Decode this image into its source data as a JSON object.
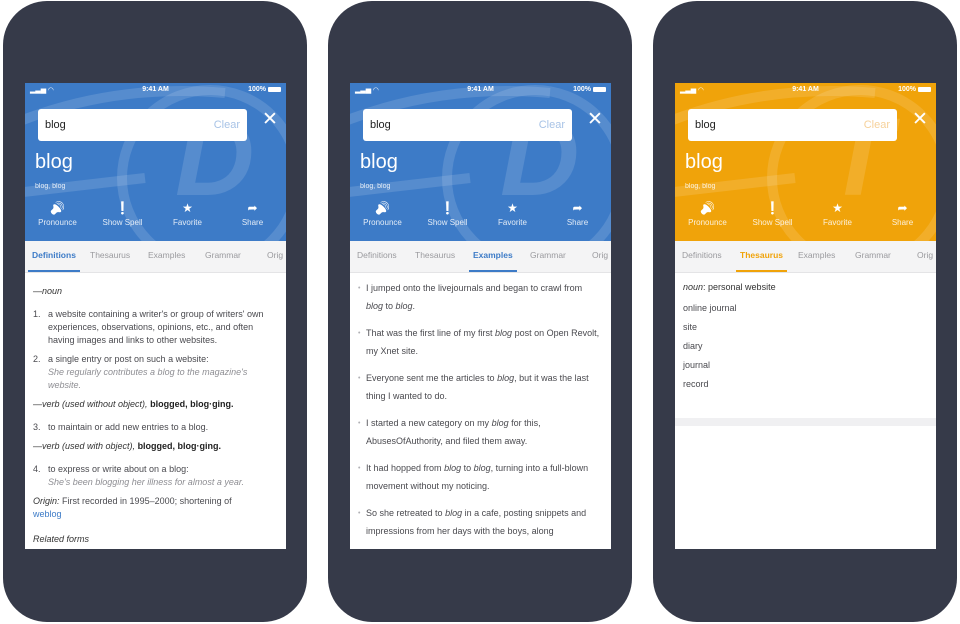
{
  "colors": {
    "blue": "#3d7bc7",
    "orange": "#f0a30a",
    "frame": "#363a49"
  },
  "phones": [
    {
      "theme": "#3d7bc7",
      "clear_color": "#a8c3e6",
      "watermark_letter": "D",
      "status": {
        "time": "9:41 AM",
        "battery": "100%"
      },
      "search": {
        "value": "blog",
        "clear": "Clear"
      },
      "close_icon": "✕",
      "word": "blog",
      "pronunciation": "blog, blog",
      "actions": [
        {
          "icon": "speaker-icon",
          "glyph": "🔊",
          "label": "Pronounce"
        },
        {
          "icon": "exclamation-icon",
          "glyph": "❗",
          "label": "Show Spell"
        },
        {
          "icon": "star-icon",
          "glyph": "★",
          "label": "Favorite"
        },
        {
          "icon": "share-icon",
          "glyph": "➦",
          "label": "Share"
        }
      ],
      "tabs": [
        "Definitions",
        "Thesaurus",
        "Examples",
        "Grammar",
        "Orig"
      ],
      "active_tab": 0,
      "definitions": {
        "noun_label": "—noun",
        "items": [
          {
            "n": "1.",
            "text": "a website containing a writer's or group of writers' own experiences, observations, opinions, etc., and often having images and links to other websites."
          },
          {
            "n": "2.",
            "text": "a single entry or post on such a website:",
            "example": "She regularly contributes a blog to the magazine's website."
          }
        ],
        "verb1_label": "—verb (used without object),",
        "verb1_forms": "blogged, blog·ging.",
        "items2": [
          {
            "n": "3.",
            "text": "to maintain or add new entries to a blog."
          }
        ],
        "verb2_label": "—verb (used with object),",
        "verb2_forms": "blogged, blog·ging.",
        "items3": [
          {
            "n": "4.",
            "text": "to express or write about on a blog:",
            "example": "She's been blogging her illness for almost a year."
          }
        ],
        "origin_label": "Origin:",
        "origin_text": "First recorded in 1995–2000; shortening of",
        "origin_link": "weblog",
        "related": "Related forms"
      }
    },
    {
      "theme": "#3d7bc7",
      "clear_color": "#a8c3e6",
      "watermark_letter": "D",
      "status": {
        "time": "9:41 AM",
        "battery": "100%"
      },
      "search": {
        "value": "blog",
        "clear": "Clear"
      },
      "close_icon": "✕",
      "word": "blog",
      "pronunciation": "blog, blog",
      "actions": [
        {
          "icon": "speaker-icon",
          "glyph": "🔊",
          "label": "Pronounce"
        },
        {
          "icon": "exclamation-icon",
          "glyph": "❗",
          "label": "Show Spell"
        },
        {
          "icon": "star-icon",
          "glyph": "★",
          "label": "Favorite"
        },
        {
          "icon": "share-icon",
          "glyph": "➦",
          "label": "Share"
        }
      ],
      "tabs": [
        "Definitions",
        "Thesaurus",
        "Examples",
        "Grammar",
        "Orig"
      ],
      "active_tab": 2,
      "examples": [
        [
          [
            "I jumped onto the livejournals and began to crawl from ",
            0
          ],
          [
            "blog",
            1
          ],
          [
            " to ",
            0
          ],
          [
            "blog",
            1
          ],
          [
            ".",
            0
          ]
        ],
        [
          [
            "That was the first line of my first ",
            0
          ],
          [
            "blog",
            1
          ],
          [
            " post on Open Revolt, my Xnet site.",
            0
          ]
        ],
        [
          [
            "Everyone sent me the articles to ",
            0
          ],
          [
            "blog",
            1
          ],
          [
            ", but it was the last thing I wanted to do.",
            0
          ]
        ],
        [
          [
            "I started a new category on my ",
            0
          ],
          [
            "blog",
            1
          ],
          [
            " for this, AbusesOfAuthority, and filed them away.",
            0
          ]
        ],
        [
          [
            "It had hopped from ",
            0
          ],
          [
            "blog",
            1
          ],
          [
            " to ",
            0
          ],
          [
            "blog",
            1
          ],
          [
            ", turning into a full-blown movement without my noticing.",
            0
          ]
        ],
        [
          [
            "So she retreated to ",
            0
          ],
          [
            "blog",
            1
          ],
          [
            " in a cafe, posting snippets and impressions from her days with the boys, along",
            0
          ]
        ]
      ]
    },
    {
      "theme": "#f0a30a",
      "clear_color": "#f6d19a",
      "watermark_letter": "T",
      "status": {
        "time": "9:41 AM",
        "battery": "100%"
      },
      "search": {
        "value": "blog",
        "clear": "Clear"
      },
      "close_icon": "✕",
      "word": "blog",
      "pronunciation": "blog, blog",
      "actions": [
        {
          "icon": "speaker-icon",
          "glyph": "🔊",
          "label": "Pronounce"
        },
        {
          "icon": "exclamation-icon",
          "glyph": "❗",
          "label": "Show Spell"
        },
        {
          "icon": "star-icon",
          "glyph": "★",
          "label": "Favorite"
        },
        {
          "icon": "share-icon",
          "glyph": "➦",
          "label": "Share"
        }
      ],
      "tabs": [
        "Definitions",
        "Thesaurus",
        "Examples",
        "Grammar",
        "Orig"
      ],
      "active_tab": 1,
      "thesaurus": {
        "pos": "noun",
        "sense": ": personal website",
        "words": [
          "online journal",
          "site",
          "diary",
          "journal",
          "record"
        ]
      }
    }
  ]
}
